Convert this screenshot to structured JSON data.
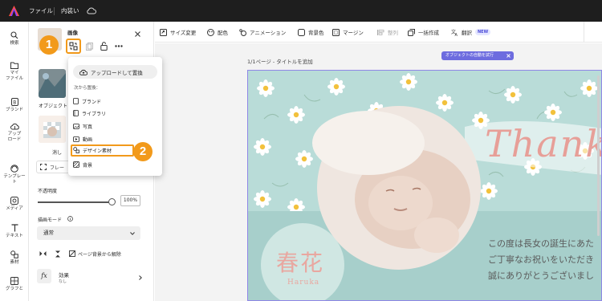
{
  "topbar": {
    "file_menu": "ファイル",
    "content_menu": "内装い"
  },
  "rail": [
    {
      "icon": "search-icon",
      "label": "検索"
    },
    {
      "icon": "folder-icon",
      "label": "マイ\nファイル"
    },
    {
      "icon": "brand-icon",
      "label": "ブランド"
    },
    {
      "icon": "upload-icon",
      "label": "アップ\nロード"
    },
    {
      "icon": "template-icon",
      "label": "テンプレー\nト"
    },
    {
      "icon": "media-icon",
      "label": "メディア"
    },
    {
      "icon": "text-icon",
      "label": "テキスト"
    },
    {
      "icon": "elements-icon",
      "label": "素材"
    },
    {
      "icon": "chart-icon",
      "label": "グラフと"
    }
  ],
  "panel": {
    "title": "画像",
    "thumb1_label": "オブジェクト",
    "thumb2_label": "消し",
    "frame_label": "フレー",
    "opacity_label": "不透明度",
    "opacity_value": 100,
    "opacity_value_text": "100%",
    "blend_label": "描画モード",
    "blend_value": "通常",
    "remove_bg_label": "ページ背景から解除",
    "effects_label": "効果",
    "effects_sub": "なし"
  },
  "popover": {
    "upload_replace": "アップロードして置換",
    "replace_from": "次から置換：",
    "items": [
      "ブランド",
      "ライブラリ",
      "写真",
      "動画",
      "デザイン素材",
      "背景"
    ]
  },
  "callouts": [
    "1",
    "2"
  ],
  "toolbar": {
    "resize": "サイズ変更",
    "color": "配色",
    "animation": "アニメーション",
    "background_color": "背景色",
    "margin": "マージン",
    "arrange": "整列",
    "bulk_create": "一括作成",
    "translate": "翻訳",
    "new_badge": "NEW"
  },
  "canvas": {
    "page_label": "1/1ページ - タイトルを追加",
    "select_pill": "オブジェクトの自動を試行",
    "thank_text": "Thank",
    "kanji_name": "春花",
    "romaji_name": "Haruka",
    "message_lines": [
      "この度は長女の誕生にあた",
      "ご丁寧なお祝いをいただき",
      "誠にありがとうございまし"
    ]
  },
  "colors": {
    "accent": "#f29a1b",
    "canvas_bg": "#b9dcd8",
    "bottom_band": "#a7cfcb",
    "pill": "#6d6cdf",
    "thank": "#e79f98",
    "name": "#e9a7a0"
  }
}
